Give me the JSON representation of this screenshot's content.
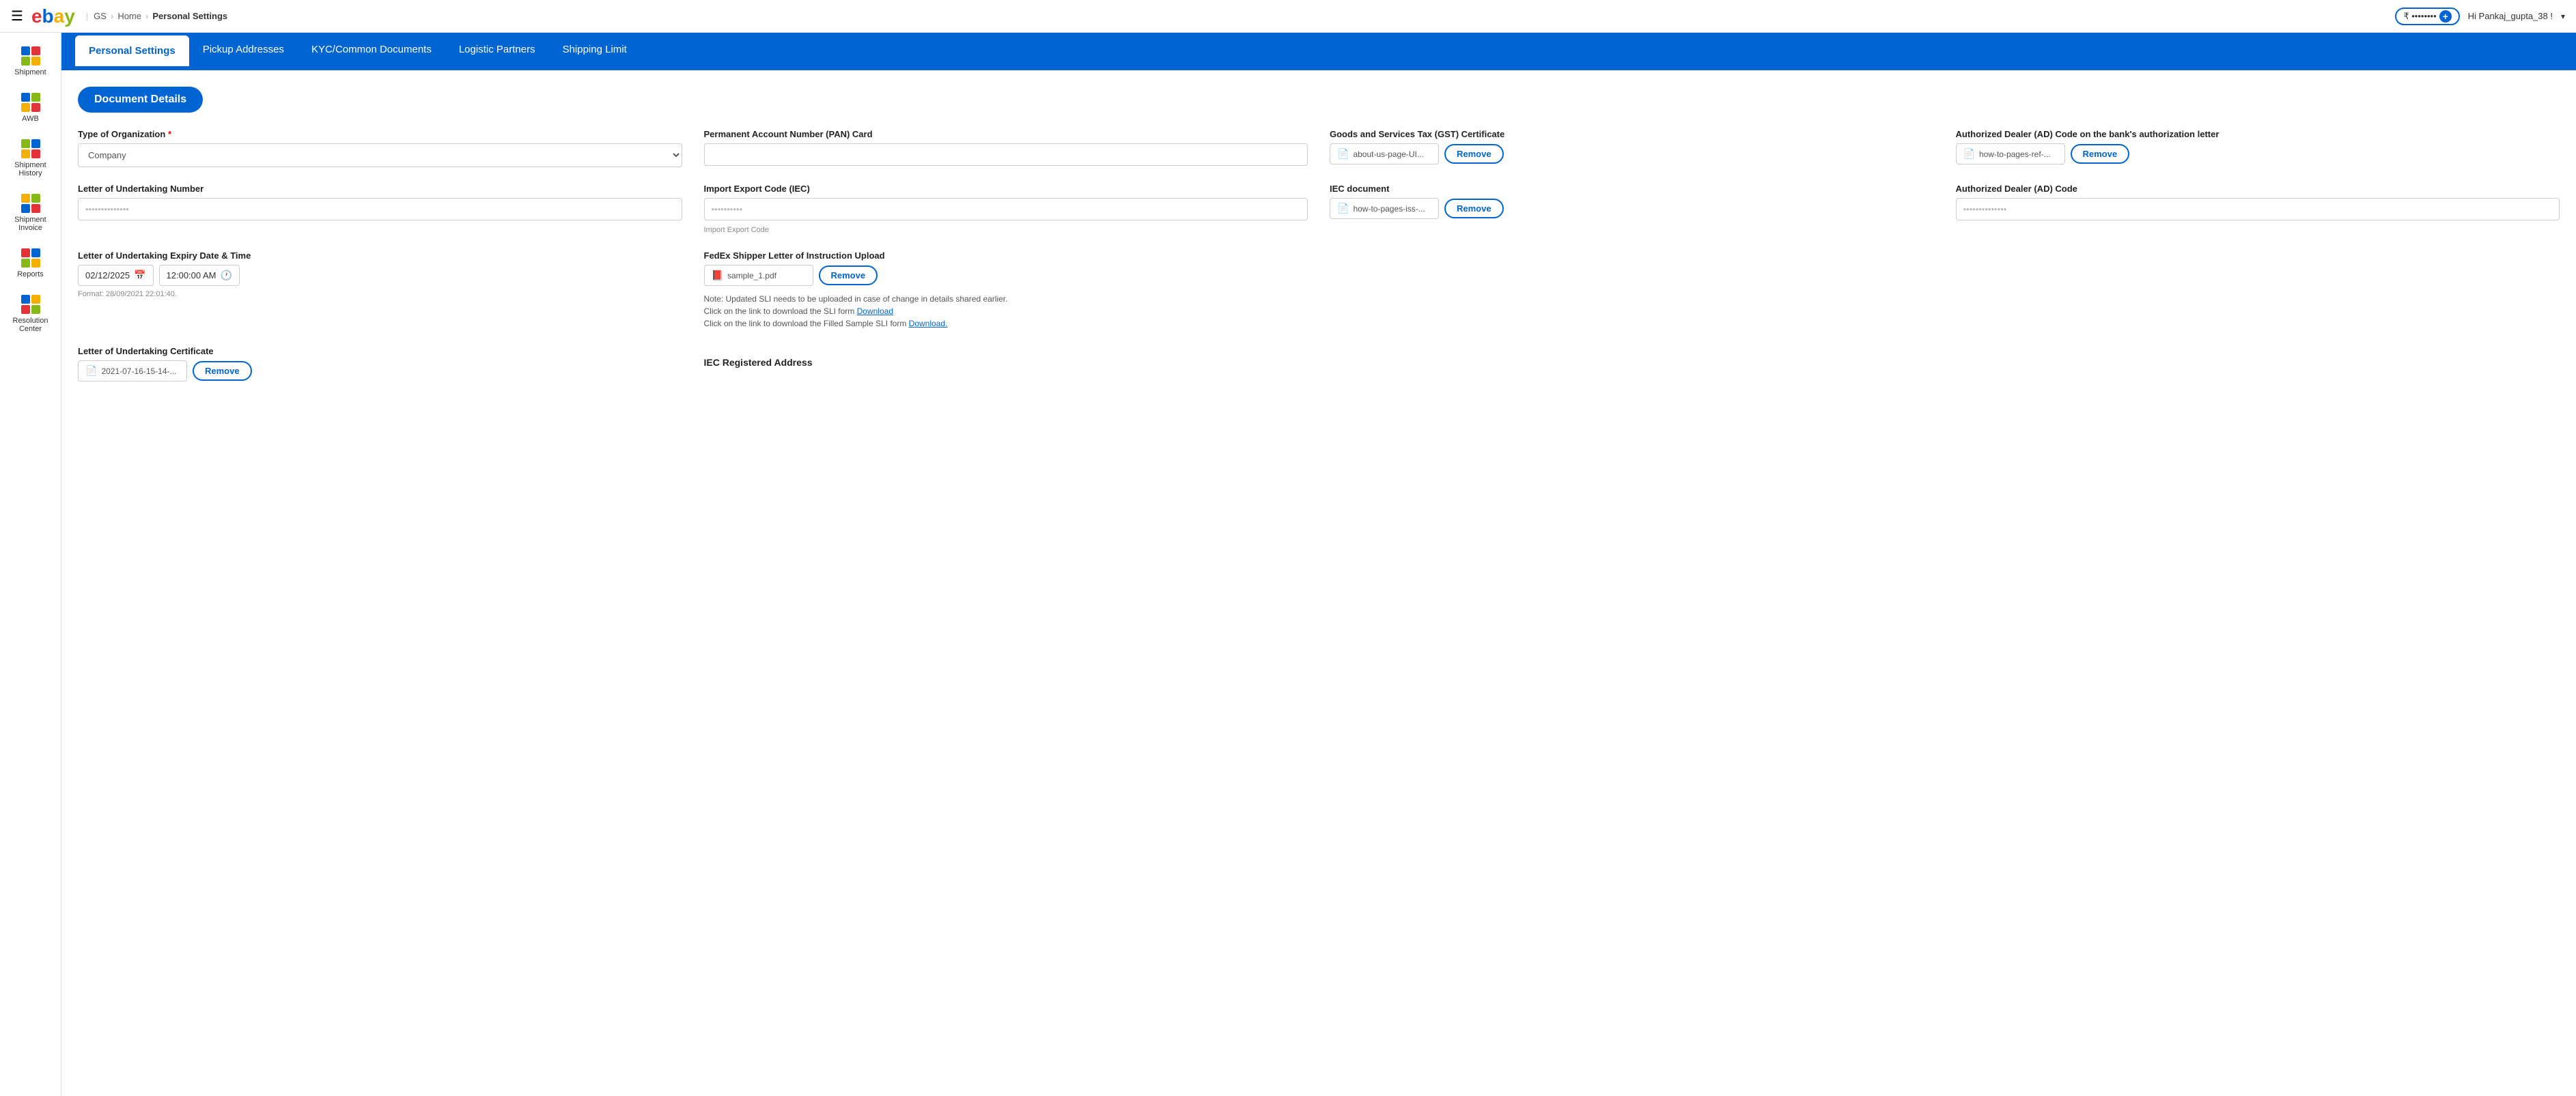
{
  "header": {
    "logo_letters": [
      "e",
      "b",
      "a",
      "y"
    ],
    "gs_label": "GS",
    "breadcrumb": [
      "Home",
      "Personal Settings"
    ],
    "balance": "₹ ••••••••",
    "hi_text": "Hi Pankaj_gupta_38 !",
    "dropdown_icon": "▾"
  },
  "sidebar": {
    "items": [
      {
        "id": "shipment",
        "label": "Shipment",
        "colors": [
          "blue",
          "red",
          "green",
          "yellow"
        ]
      },
      {
        "id": "awb",
        "label": "AWB",
        "colors": [
          "blue",
          "green",
          "yellow",
          "red"
        ]
      },
      {
        "id": "shipment-history",
        "label": "Shipment History",
        "colors": [
          "green",
          "blue",
          "yellow",
          "red"
        ]
      },
      {
        "id": "shipment-invoice",
        "label": "Shipment Invoice",
        "colors": [
          "yellow",
          "green",
          "blue",
          "red"
        ]
      },
      {
        "id": "reports",
        "label": "Reports",
        "colors": [
          "red",
          "blue",
          "green",
          "yellow"
        ]
      },
      {
        "id": "resolution-center",
        "label": "Resolution Center",
        "colors": [
          "blue",
          "yellow",
          "red",
          "green"
        ]
      }
    ]
  },
  "nav": {
    "tabs": [
      {
        "id": "personal-settings",
        "label": "Personal Settings",
        "active": true
      },
      {
        "id": "pickup-addresses",
        "label": "Pickup Addresses",
        "active": false
      },
      {
        "id": "kyc-documents",
        "label": "KYC/Common Documents",
        "active": false
      },
      {
        "id": "logistic-partners",
        "label": "Logistic Partners",
        "active": false
      },
      {
        "id": "shipping-limit",
        "label": "Shipping Limit",
        "active": false
      }
    ]
  },
  "form": {
    "section_title": "Document Details",
    "fields": {
      "type_of_org_label": "Type of Organization",
      "type_of_org_required": "*",
      "type_of_org_value": "Company",
      "pan_label": "Permanent Account Number (PAN) Card",
      "pan_value": "",
      "pan_placeholder": "",
      "gst_label": "Goods and Services Tax (GST) Certificate",
      "gst_file": "about-us-page-UI...",
      "gst_remove": "Remove",
      "ad_code_letter_label": "Authorized Dealer (AD) Code on the bank's authorization letter",
      "ad_code_letter_file": "how-to-pages-ref-...",
      "ad_code_letter_remove": "Remove",
      "lou_number_label": "Letter of Undertaking Number",
      "lou_number_value": "••••••••••••••",
      "iec_label": "Import Export Code (IEC)",
      "iec_value": "••••••••••",
      "iec_hint": "Import Export Code",
      "iec_doc_label": "IEC document",
      "iec_doc_file": "how-to-pages-iss-...",
      "iec_doc_remove": "Remove",
      "ad_code_label": "Authorized Dealer (AD) Code",
      "ad_code_value": "••••••••••••••",
      "lou_expiry_label": "Letter of Undertaking Expiry Date & Time",
      "lou_date": "02/12/2025",
      "lou_time": "12:00:00 AM",
      "lou_format_hint": "Format: 28/09/2021 22:01:40.",
      "fedex_label": "FedEx Shipper Letter of Instruction Upload",
      "fedex_file": "sample_1.pdf",
      "fedex_remove": "Remove",
      "fedex_note1": "Note: Updated SLI needs to be uploaded in case of change in details shared earlier.",
      "fedex_note2": "Click on the link to download the SLI form",
      "fedex_download1": "Download",
      "fedex_note3": "Click on the link to download the Filled Sample SLI form",
      "fedex_download2": "Download.",
      "lou_cert_label": "Letter of Undertaking Certificate",
      "lou_cert_file": "2021-07-16-15-14-...",
      "lou_cert_remove": "Remove",
      "iec_address_label": "IEC Registered Address"
    }
  }
}
